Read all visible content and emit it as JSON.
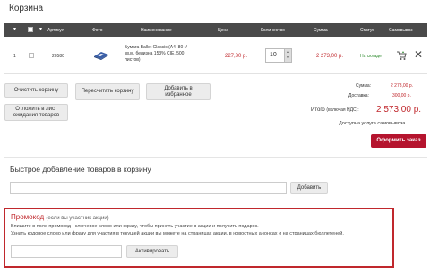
{
  "page": {
    "title": "Корзина"
  },
  "table": {
    "headers": {
      "article": "Артикул",
      "photo": "Фото",
      "name": "Наименование",
      "price": "Цена",
      "quantity": "Количество",
      "sum": "Сумма",
      "status": "Статус",
      "pickup": "Самовывоз"
    },
    "rows": [
      {
        "num": "1",
        "article": "20580",
        "name": "Бумага Ballet Classic (A4, 80 г/кв.м, белизна 153% CIE, 500 листов)",
        "price": "227,30 р.",
        "quantity": "10",
        "sum": "2 273,00 р.",
        "status": "На складе"
      }
    ]
  },
  "buttons": {
    "clear": "Очистить корзину",
    "recalc": "Пересчитать корзину",
    "favorites": "Добавить в избранное",
    "postpone": "Отложить в лист ожидания товаров",
    "order": "Оформить заказ",
    "add": "Добавить",
    "activate": "Активировать"
  },
  "totals": {
    "sum_label": "Сумма:",
    "sum_value": "2 273,00 р.",
    "delivery_label": "Доставка:",
    "delivery_value": "300,00 р.",
    "total_label": "Итого",
    "total_vat": "(включая НДС):",
    "total_value": "2 573,00 р.",
    "pickup_note": "Доступна услуга самовывоза"
  },
  "quick_add": {
    "title": "Быстрое добавление товаров в корзину"
  },
  "promo": {
    "title": "Промокод",
    "hint": "(если вы участник акции)",
    "line1": "Впишите в поле промокод - ключевое слово или фразу, чтобы принять участие в акции и получить подарок.",
    "line2": "Узнать кодовое слово или фразу для участия в текущей акции вы можете на страницах акции, в новостных анонсах и на страницах бюллетеней."
  },
  "colors": {
    "accent": "#c0282d",
    "order_button": "#b5142e",
    "header_bg": "#4a4a4a",
    "in_stock": "#2e8b2e"
  }
}
